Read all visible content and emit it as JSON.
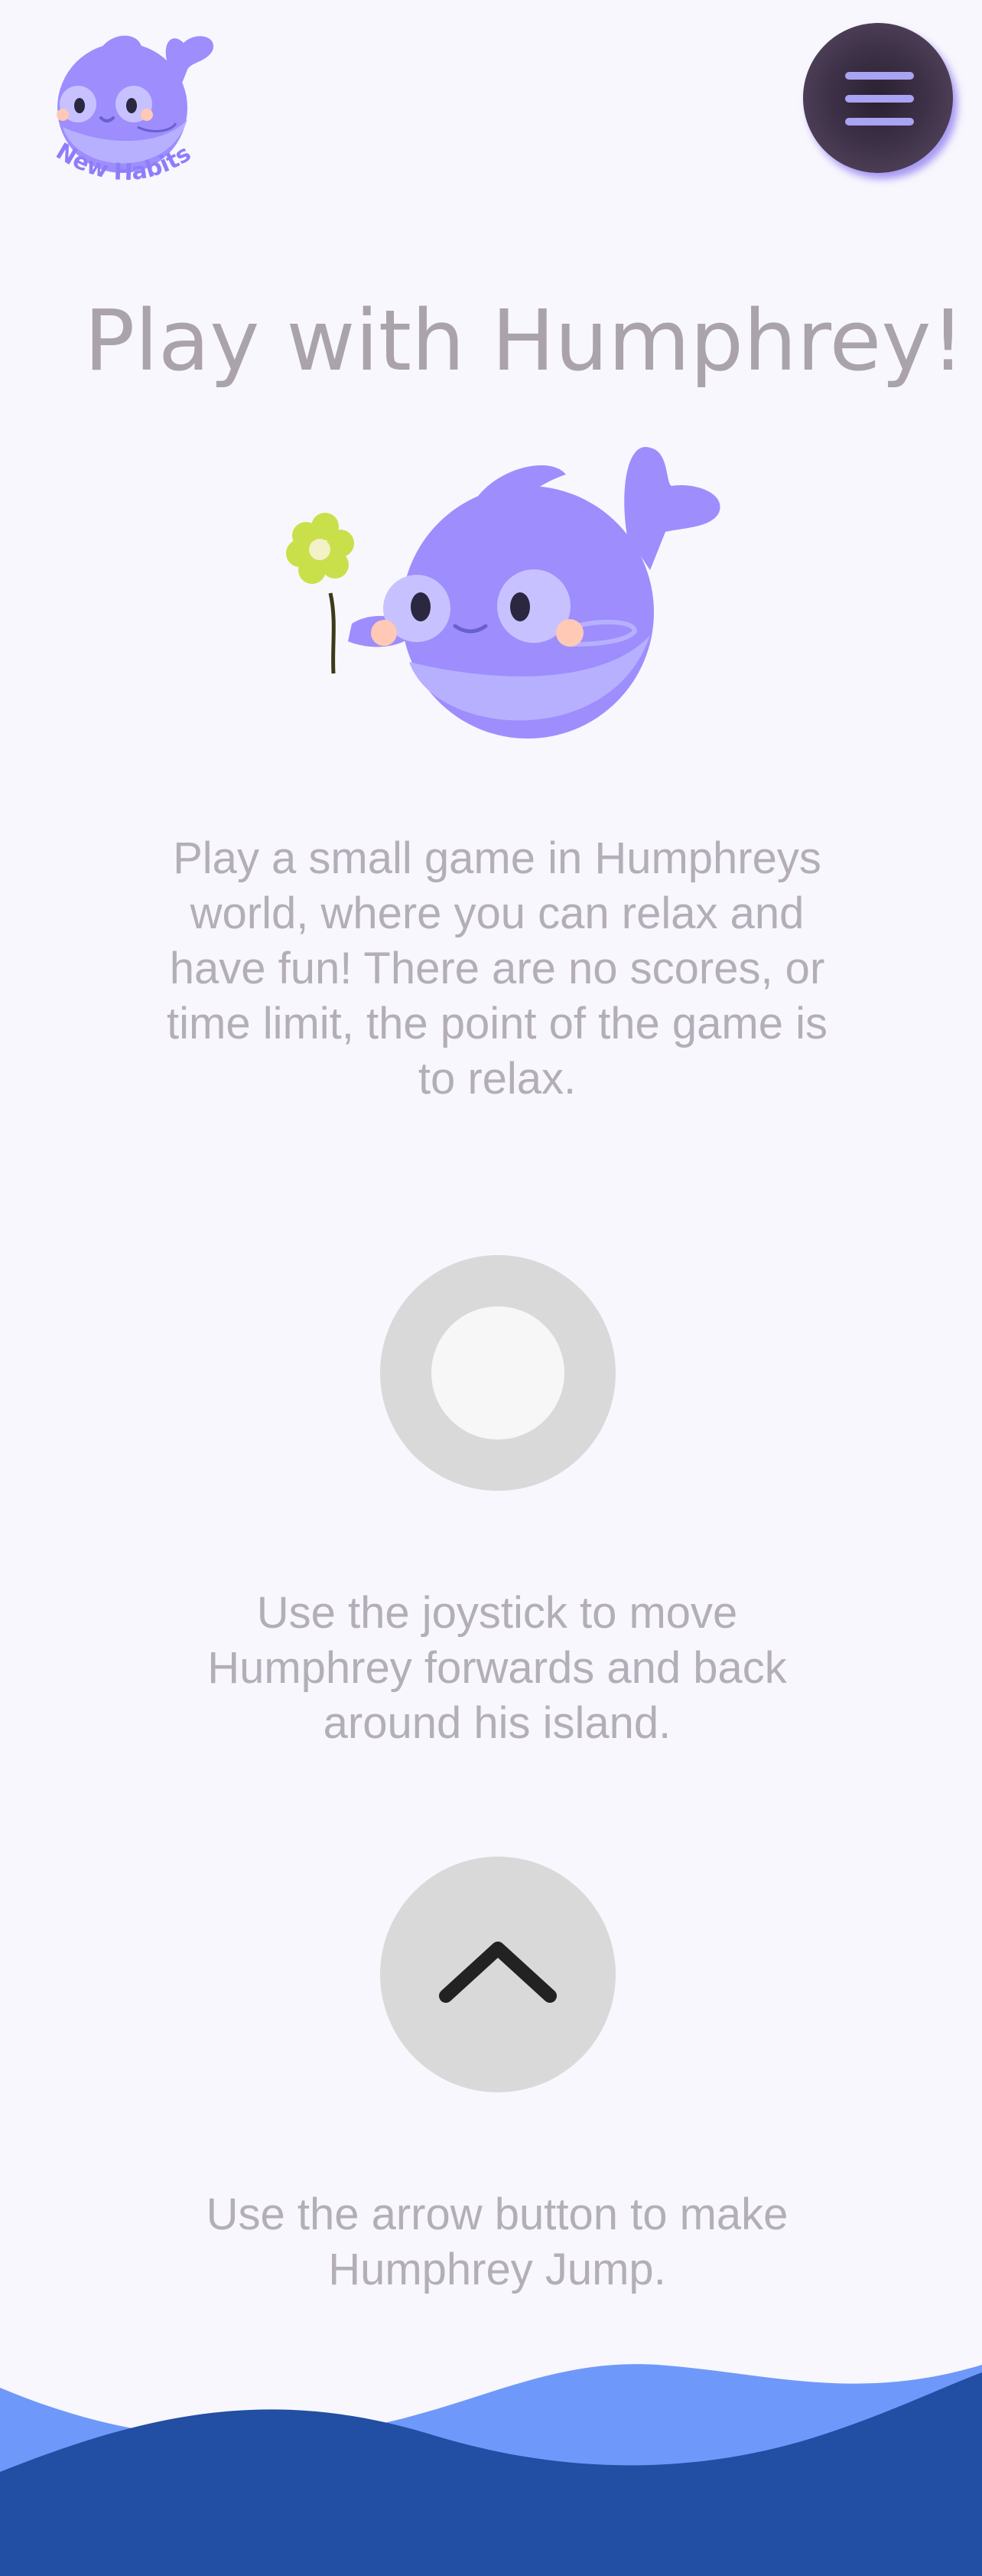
{
  "header": {
    "logo_text": "New Habits",
    "menu_icon": "hamburger-menu-icon"
  },
  "page": {
    "title": "Play with Humphrey!",
    "intro": "Play a small game in Humphreys world, where you can relax and have fun! There are no scores, or time limit, the point of the game is to relax.",
    "joystick_text": "Use the joystick to move Humphrey forwards and back around his island.",
    "arrow_text": "Use the arrow button to make Humphrey Jump."
  },
  "controls": {
    "joystick_icon": "joystick-icon",
    "jump_icon": "chevron-up-icon"
  },
  "colors": {
    "background": "#f8f7fd",
    "whale": "#9d8dfd",
    "whale_belly": "#b6b0ff",
    "title_text": "#aaa3ac",
    "body_text": "#b3aeb8",
    "menu_button": "#3d3148",
    "wave_light": "#6e99fa",
    "wave_dark": "#224ea3"
  }
}
